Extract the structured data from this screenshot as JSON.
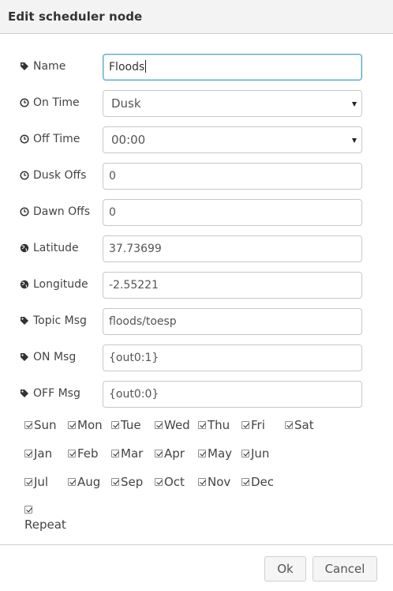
{
  "dialog": {
    "title": "Edit scheduler node"
  },
  "fields": [
    {
      "label": "Name",
      "icon": "tag-icon",
      "value": "Floods"
    },
    {
      "label": "On Time",
      "icon": "clock-icon",
      "value": "Dusk"
    },
    {
      "label": "Off Time",
      "icon": "clock-icon",
      "value": "00:00"
    },
    {
      "label": "Dusk Offs",
      "icon": "clock-icon",
      "value": "0"
    },
    {
      "label": "Dawn Offs",
      "icon": "clock-icon",
      "value": "0"
    },
    {
      "label": "Latitude",
      "icon": "globe-icon",
      "value": "37.73699"
    },
    {
      "label": "Longitude",
      "icon": "globe-icon",
      "value": "-2.55221"
    },
    {
      "label": "Topic Msg",
      "icon": "tag-icon",
      "value": "floods/toesp"
    },
    {
      "label": "ON Msg",
      "icon": "tag-icon",
      "value": "{out0:1}"
    },
    {
      "label": "OFF Msg",
      "icon": "tag-icon",
      "value": "{out0:0}"
    }
  ],
  "days": [
    "Sun",
    "Mon",
    "Tue",
    "Wed",
    "Thu",
    "Fri",
    "Sat"
  ],
  "months_row1": [
    "Jan",
    "Feb",
    "Mar",
    "Apr",
    "May",
    "Jun"
  ],
  "months_row2": [
    "Jul",
    "Aug",
    "Sep",
    "Oct",
    "Nov",
    "Dec"
  ],
  "repeat": {
    "label": "Repeat",
    "checked": true
  },
  "buttons": {
    "ok": "Ok",
    "cancel": "Cancel"
  },
  "colors": {
    "focus_border": "#62a8c7",
    "header_bg": "#f3f3f3"
  }
}
